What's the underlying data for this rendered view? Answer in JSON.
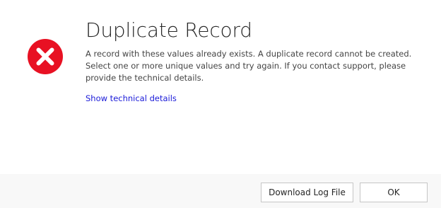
{
  "dialog": {
    "title": "Duplicate Record",
    "message": "A record with these values already exists. A duplicate record cannot be created. Select one or more unique values and try again. If you contact support, please provide the technical details.",
    "tech_details_link": "Show technical details",
    "icon": "error-x-icon",
    "icon_color": "#e81123"
  },
  "footer": {
    "download_log_label": "Download Log File",
    "ok_label": "OK"
  }
}
